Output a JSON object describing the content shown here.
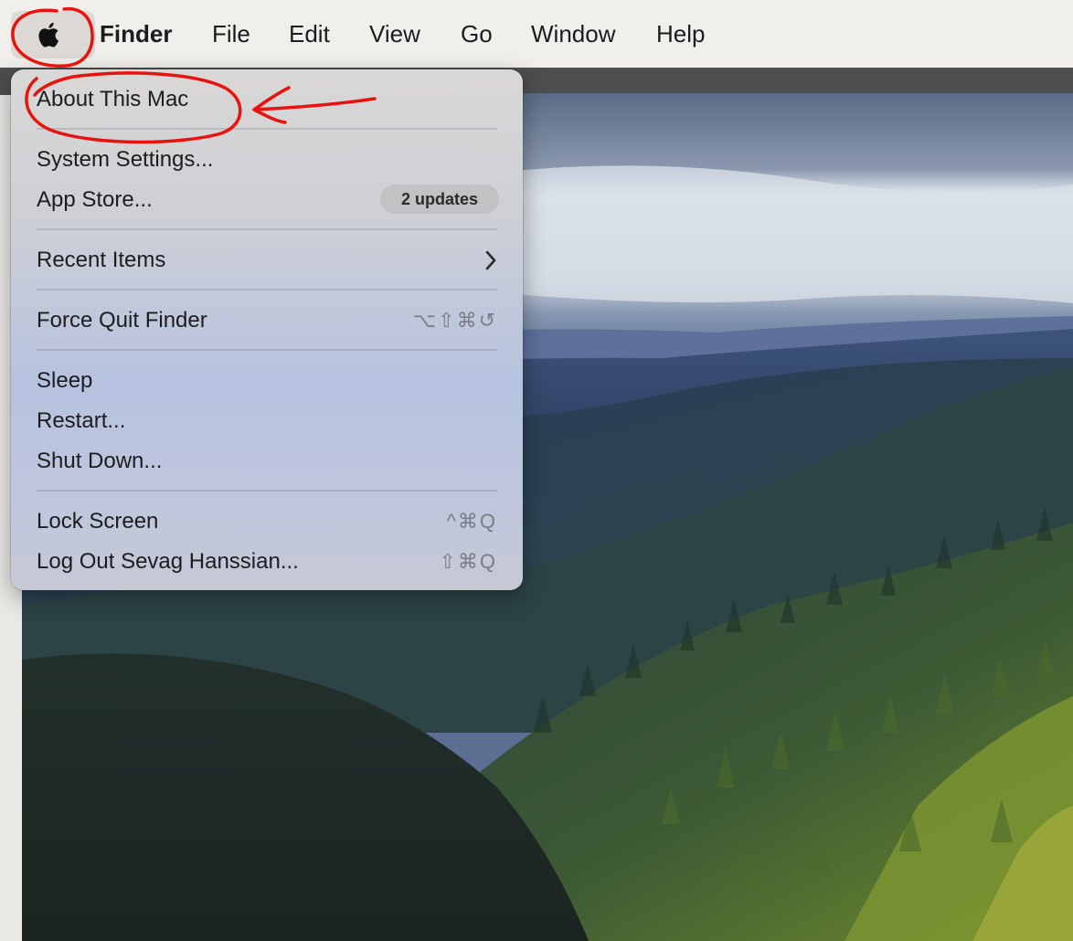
{
  "menubar": {
    "app_name": "Finder",
    "items": [
      "File",
      "Edit",
      "View",
      "Go",
      "Window",
      "Help"
    ]
  },
  "apple_menu": {
    "about": "About This Mac",
    "system_settings": "System Settings...",
    "app_store": "App Store...",
    "app_store_badge": "2 updates",
    "recent_items": "Recent Items",
    "force_quit": "Force Quit Finder",
    "force_quit_shortcut": "⌥⇧⌘↺",
    "sleep": "Sleep",
    "restart": "Restart...",
    "shut_down": "Shut Down...",
    "lock_screen": "Lock Screen",
    "lock_screen_shortcut": "^⌘Q",
    "log_out": "Log Out Sevag Hanssian...",
    "log_out_shortcut": "⇧⌘Q"
  },
  "annotation": {
    "color": "#e8130f"
  },
  "icons": [
    "apple-icon",
    "chevron-right-icon"
  ]
}
